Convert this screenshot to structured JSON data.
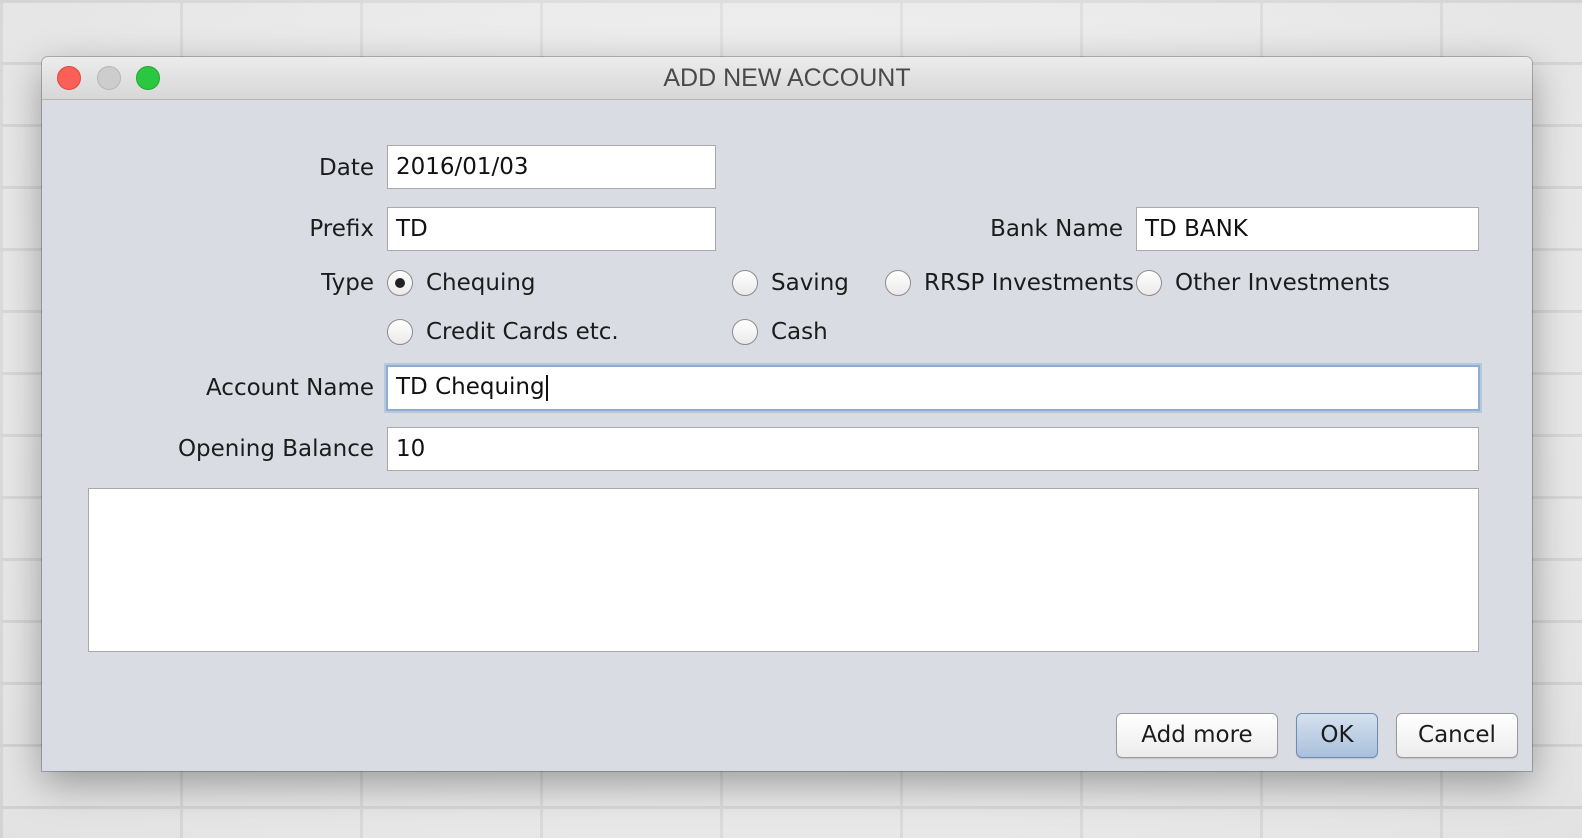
{
  "window": {
    "title": "ADD NEW ACCOUNT"
  },
  "form": {
    "date": {
      "label": "Date",
      "value": "2016/01/03"
    },
    "prefix": {
      "label": "Prefix",
      "value": "TD"
    },
    "bank_name": {
      "label": "Bank Name",
      "value": "TD BANK"
    },
    "type": {
      "label": "Type",
      "selected": "Chequing",
      "options": [
        "Chequing",
        "Saving",
        "RRSP Investments",
        "Other Investments",
        "Credit Cards etc.",
        "Cash"
      ]
    },
    "account_name": {
      "label": "Account Name",
      "value": "TD Chequing"
    },
    "opening_balance": {
      "label": "Opening Balance",
      "value": "10"
    },
    "notes": {
      "value": ""
    }
  },
  "buttons": {
    "add_more": "Add more",
    "ok": "OK",
    "cancel": "Cancel"
  },
  "colors": {
    "close": "#fc5f57",
    "minimize": "#cdcdcd",
    "maximize": "#2ac840",
    "window_bg": "#d9dce2",
    "default_button": "#a9c0dc"
  }
}
